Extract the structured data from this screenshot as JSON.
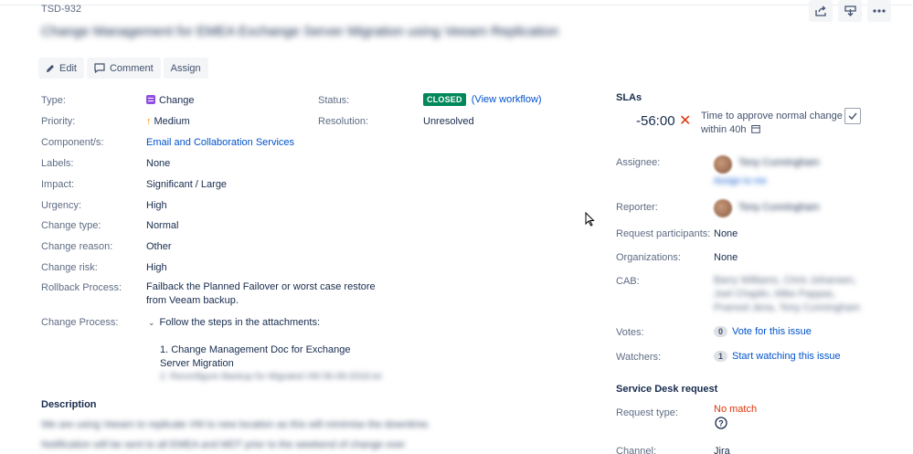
{
  "issue": {
    "key": "TSD-932",
    "title": "Change Management for EMEA Exchange Server Migration using Veeam Replication"
  },
  "toolbar": {
    "edit": "Edit",
    "comment": "Comment",
    "assign": "Assign"
  },
  "fields": {
    "type": {
      "label": "Type:",
      "value": "Change"
    },
    "status": {
      "label": "Status:",
      "value": "CLOSED",
      "link": "(View workflow)"
    },
    "priority": {
      "label": "Priority:",
      "value": "Medium"
    },
    "resolution": {
      "label": "Resolution:",
      "value": "Unresolved"
    },
    "components": {
      "label": "Component/s:",
      "value": "Email and Collaboration Services"
    },
    "labels": {
      "label": "Labels:",
      "value": "None"
    },
    "impact": {
      "label": "Impact:",
      "value": "Significant / Large"
    },
    "urgency": {
      "label": "Urgency:",
      "value": "High"
    },
    "change_type": {
      "label": "Change type:",
      "value": "Normal"
    },
    "change_reason": {
      "label": "Change reason:",
      "value": "Other"
    },
    "change_risk": {
      "label": "Change risk:",
      "value": "High"
    },
    "rollback": {
      "label": "Rollback Process:",
      "value": "Failback the Planned Failover or worst case restore from Veeam backup."
    },
    "change_process": {
      "label": "Change Process:",
      "toggle": "Follow the steps in the attachments:",
      "step1": "1. Change Management Doc for Exchange Server Migration",
      "step2": "2. Reconfigure Backup for Migrated VM 06-09-2018.txt"
    }
  },
  "description": {
    "heading": "Description",
    "line1": "We are using Veeam to replicate VM to new location as this will minimise the downtime.",
    "line2": "Notification will be sent to all EMEA and MDT prior to the weekend of change over"
  },
  "slas": {
    "heading": "SLAs",
    "time": "-56:00",
    "goal": "Time to approve normal change",
    "within": "within 40h"
  },
  "people": {
    "assignee_label": "Assignee:",
    "assignee_name": "Tony Cunningham",
    "assign_to_me": "Assign to me",
    "reporter_label": "Reporter:",
    "reporter_name": "Tony Cunningham",
    "participants_label": "Request participants:",
    "participants_value": "None",
    "orgs_label": "Organizations:",
    "orgs_value": "None",
    "cab_label": "CAB:",
    "cab_value": "Barry Williams, Chris Johansen, Joel Chaplin, Mike Pappas, Pramod Jena, Tony Cunningham",
    "votes_label": "Votes:",
    "votes_count": "0",
    "votes_link": "Vote for this issue",
    "watchers_label": "Watchers:",
    "watchers_count": "1",
    "watchers_link": "Start watching this issue"
  },
  "service_desk": {
    "heading": "Service Desk request",
    "request_type_label": "Request type:",
    "request_type_value": "No match",
    "channel_label": "Channel:",
    "channel_value": "Jira"
  },
  "colors": {
    "link": "#0052cc",
    "closed": "#00875a",
    "error": "#de350b",
    "change_type": "#904ee2",
    "priority_medium": "#ff8b00"
  }
}
